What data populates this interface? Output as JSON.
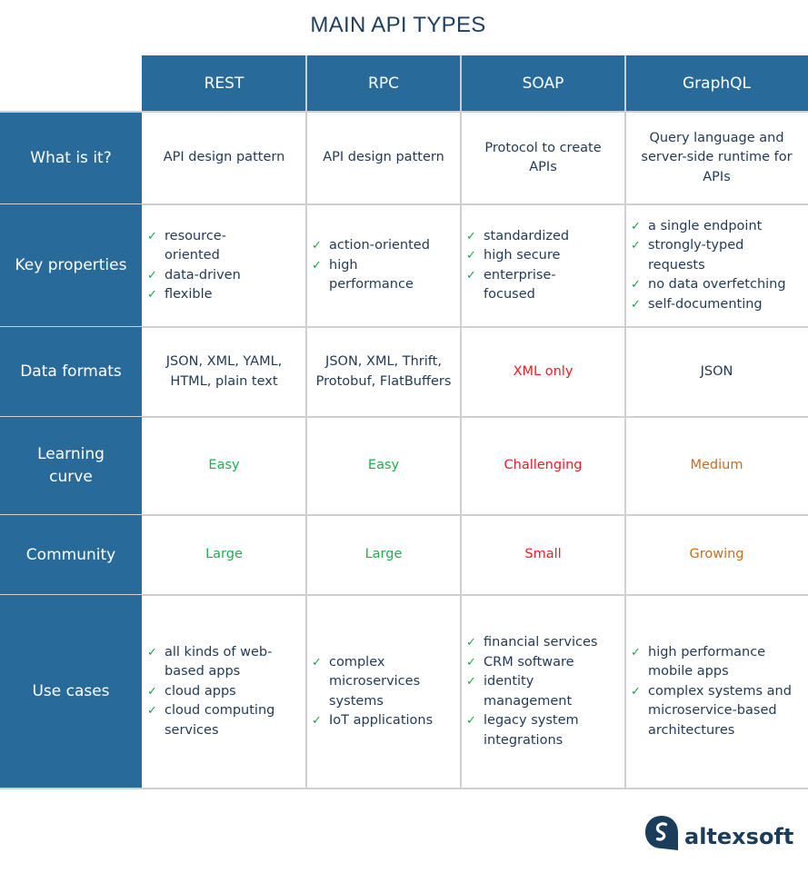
{
  "title": "MAIN API TYPES",
  "columns": [
    "REST",
    "RPC",
    "SOAP",
    "GraphQL"
  ],
  "rows": [
    {
      "label": "What is it?",
      "cells": [
        {
          "type": "text",
          "text": "API design pattern"
        },
        {
          "type": "text",
          "text": "API design pattern"
        },
        {
          "type": "text",
          "text": "Protocol to create APIs"
        },
        {
          "type": "text",
          "text": "Query language and server-side runtime for APIs"
        }
      ]
    },
    {
      "label": "Key properties",
      "cells": [
        {
          "type": "list",
          "items": [
            "resource-oriented",
            "data-driven",
            "flexible"
          ]
        },
        {
          "type": "list",
          "items": [
            "action-oriented",
            "high performance"
          ]
        },
        {
          "type": "list",
          "items": [
            "standardized",
            "high secure",
            "enterprise-focused"
          ]
        },
        {
          "type": "list",
          "items": [
            "a single endpoint",
            "strongly-typed requests",
            "no data overfetching",
            "self-documenting"
          ]
        }
      ]
    },
    {
      "label": "Data formats",
      "cells": [
        {
          "type": "text",
          "text": "JSON, XML, YAML, HTML, plain text"
        },
        {
          "type": "text",
          "text": "JSON, XML, Thrift, Protobuf, FlatBuffers"
        },
        {
          "type": "text",
          "text": "XML only",
          "tone": "red"
        },
        {
          "type": "text",
          "text": "JSON"
        }
      ]
    },
    {
      "label": "Learning curve",
      "cells": [
        {
          "type": "text",
          "text": "Easy",
          "tone": "green"
        },
        {
          "type": "text",
          "text": "Easy",
          "tone": "green"
        },
        {
          "type": "text",
          "text": "Challenging",
          "tone": "red"
        },
        {
          "type": "text",
          "text": "Medium",
          "tone": "orange"
        }
      ]
    },
    {
      "label": "Community",
      "cells": [
        {
          "type": "text",
          "text": "Large",
          "tone": "green"
        },
        {
          "type": "text",
          "text": "Large",
          "tone": "green"
        },
        {
          "type": "text",
          "text": "Small",
          "tone": "red"
        },
        {
          "type": "text",
          "text": "Growing",
          "tone": "orange"
        }
      ]
    },
    {
      "label": "Use cases",
      "cells": [
        {
          "type": "list",
          "items": [
            "all kinds of web-based apps",
            "cloud apps",
            "cloud computing services"
          ]
        },
        {
          "type": "list",
          "items": [
            "complex microservices systems",
            "IoT applications"
          ]
        },
        {
          "type": "list",
          "items": [
            "financial services",
            "CRM software",
            "identity management",
            "legacy system integrations"
          ]
        },
        {
          "type": "list",
          "items": [
            "high performance mobile apps",
            "complex systems and microservice-based architectures"
          ]
        }
      ]
    }
  ],
  "check_icon": "checkmark-icon",
  "check_glyph": "✓",
  "colors": {
    "header_bg": "#286a9a",
    "text_dark": "#1f3a57",
    "green": "#1fae4e",
    "red": "#ee1c24",
    "orange": "#cc6a1e",
    "grid": "#cfcfcf"
  },
  "brand": {
    "name": "altexsoft"
  }
}
